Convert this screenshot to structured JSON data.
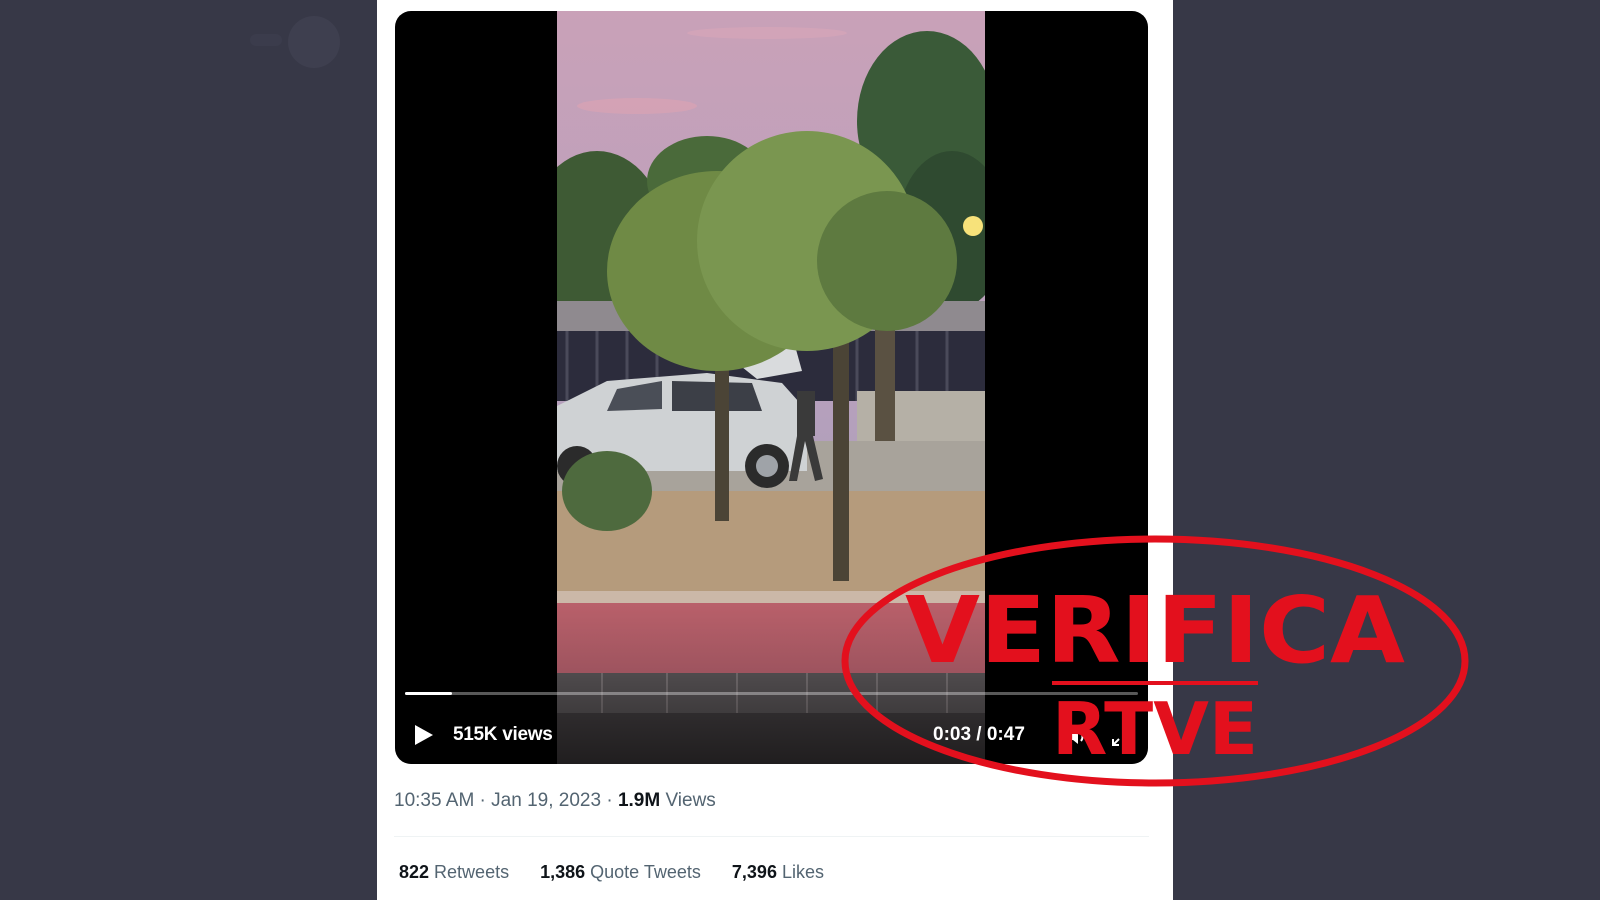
{
  "video": {
    "views": "515K views",
    "time": "0:03 / 0:47",
    "progress": 0.064
  },
  "tweet": {
    "time": "10:35 AM",
    "sep1": " · ",
    "date": "Jan 19, 2023",
    "sep2": " · ",
    "view_count": "1.9M",
    "view_label": " Views"
  },
  "stats": {
    "retweets_count": "822",
    "retweets_label": " Retweets",
    "quote_count": "1,386",
    "quote_label": " Quote Tweets",
    "likes_count": "7,396",
    "likes_label": " Likes"
  },
  "watermark": {
    "line1": "VERIFICA",
    "line2": "RTVE",
    "color": "#e3101d"
  },
  "icons": [
    "play-icon",
    "volume-icon",
    "fullscreen-icon"
  ],
  "colors": {
    "background": "#373847",
    "panel": "#ffffff",
    "muted": "#536471",
    "text": "#0f1419"
  }
}
